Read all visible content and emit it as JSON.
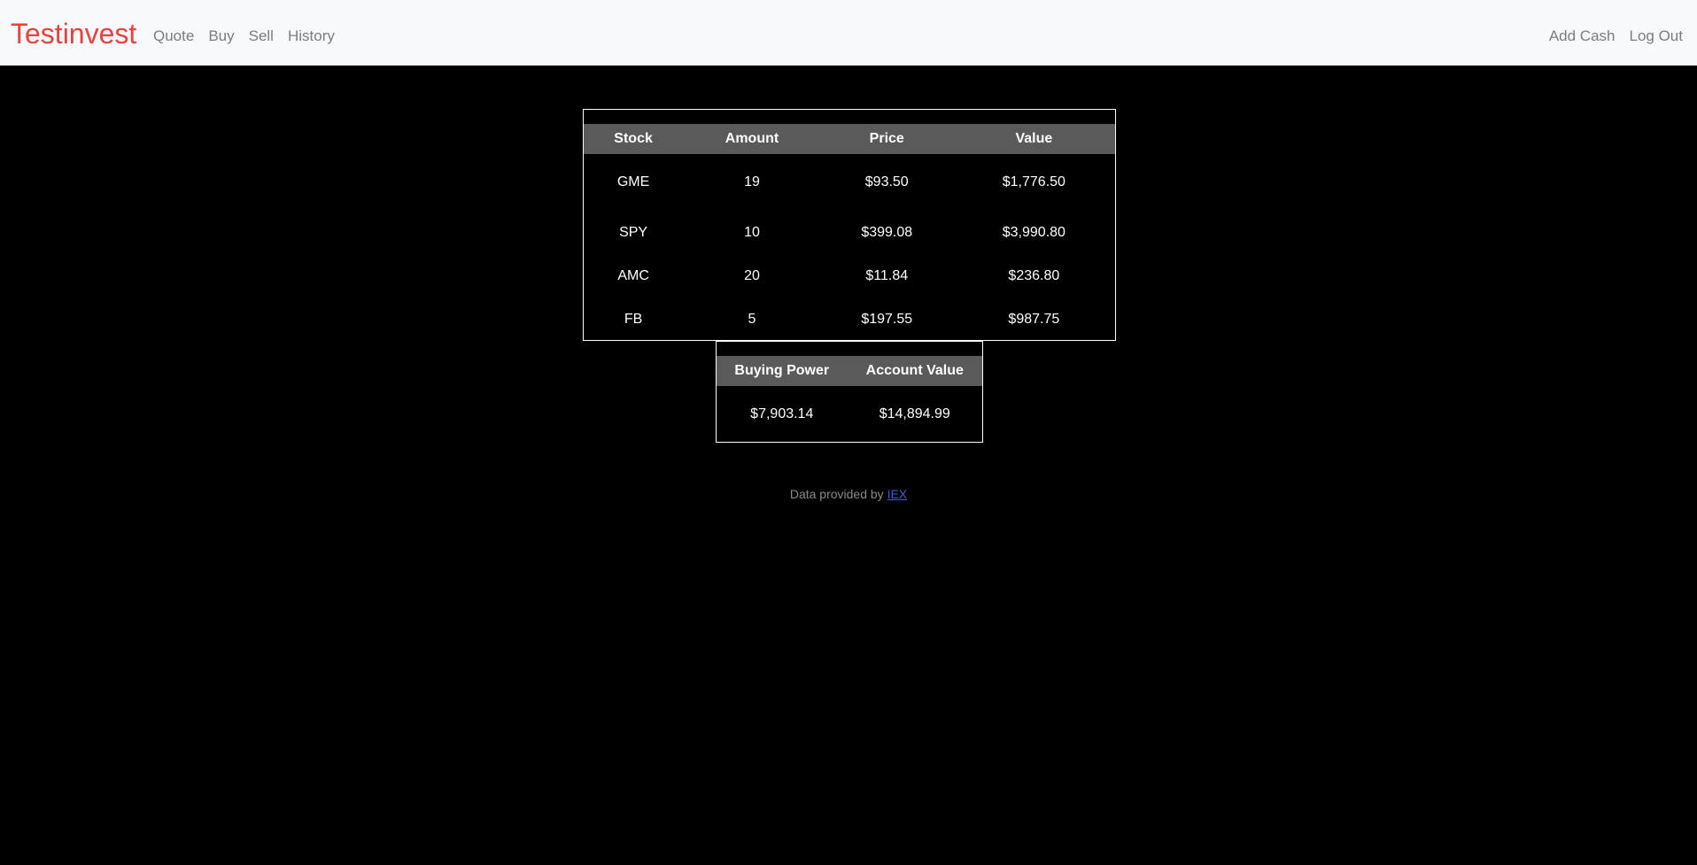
{
  "app": {
    "brand": "Testinvest"
  },
  "nav": {
    "left": [
      "Quote",
      "Buy",
      "Sell",
      "History"
    ],
    "right": [
      "Add Cash",
      "Log Out"
    ]
  },
  "holdings": {
    "headers": [
      "Stock",
      "Amount",
      "Price",
      "Value"
    ],
    "rows": [
      [
        "GME",
        "19",
        "$93.50",
        "$1,776.50"
      ],
      [
        "SPY",
        "10",
        "$399.08",
        "$3,990.80"
      ],
      [
        "AMC",
        "20",
        "$11.84",
        "$236.80"
      ],
      [
        "FB",
        "5",
        "$197.55",
        "$987.75"
      ]
    ]
  },
  "summary": {
    "headers": [
      "Buying Power",
      "Account Value"
    ],
    "values": [
      "$7,903.14",
      "$14,894.99"
    ]
  },
  "footer": {
    "text": "Data provided by ",
    "link": "IEX"
  },
  "colors": {
    "brand": "#e8423f",
    "background": "#000000",
    "navbar": "#f8f9fa",
    "header_row": "#5a5a5a",
    "link": "#3b5bdb"
  }
}
